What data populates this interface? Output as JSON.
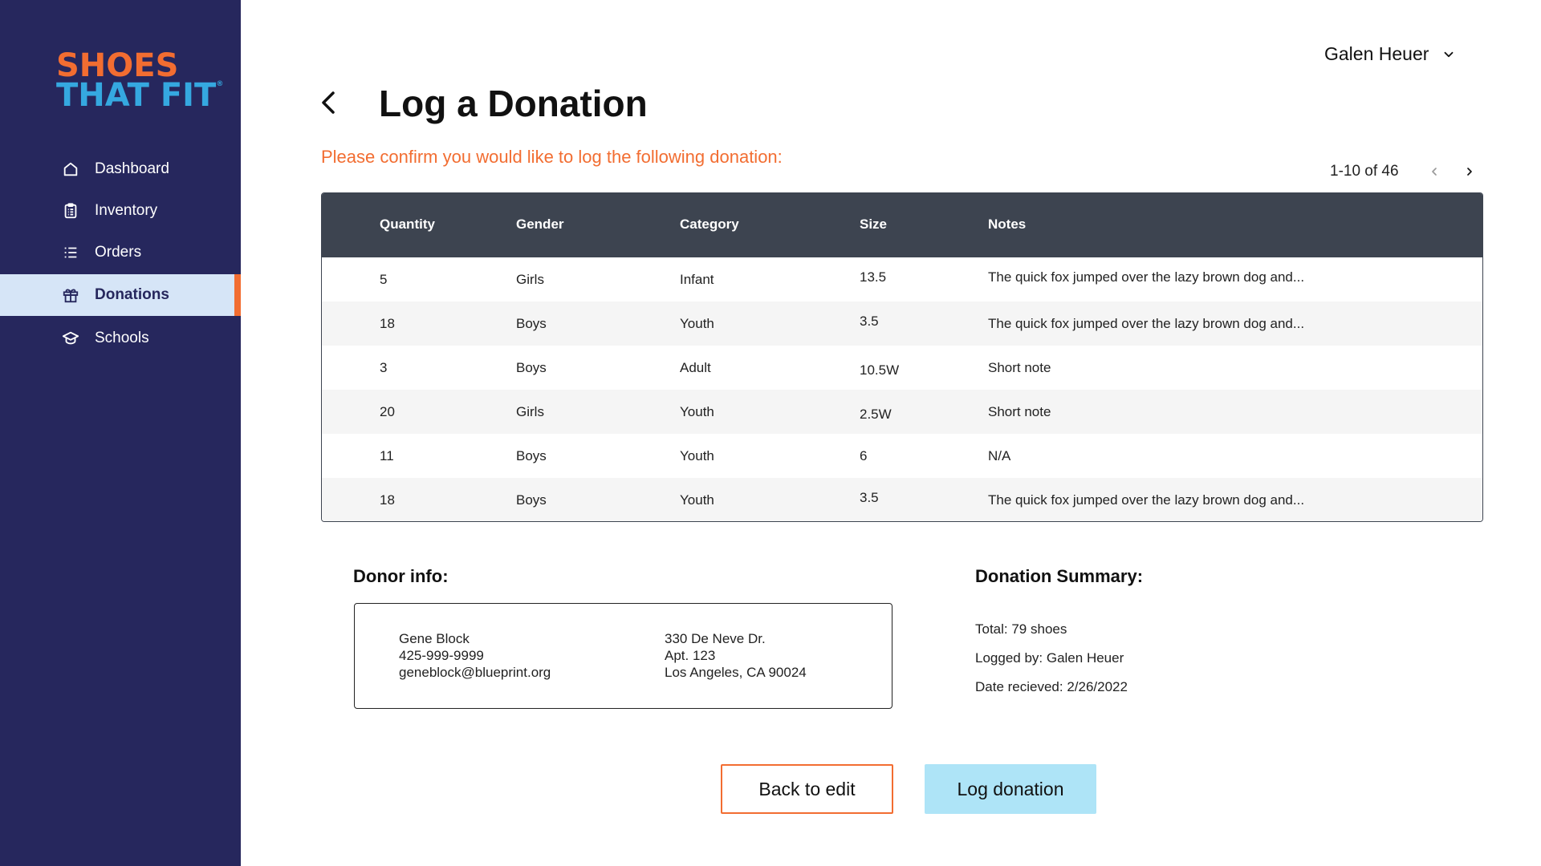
{
  "brand": {
    "line1": "SHOES",
    "line2": "THAT FIT",
    "mark": "®",
    "colors": {
      "orange": "#f26d31",
      "blue": "#35a8e0",
      "sidebar": "#26275d"
    }
  },
  "sidebar": {
    "items": [
      {
        "label": "Dashboard",
        "icon": "home-icon",
        "active": false
      },
      {
        "label": "Inventory",
        "icon": "clipboard-icon",
        "active": false
      },
      {
        "label": "Orders",
        "icon": "list-icon",
        "active": false
      },
      {
        "label": "Donations",
        "icon": "gift-icon",
        "active": true
      },
      {
        "label": "Schools",
        "icon": "graduation-cap-icon",
        "active": false
      }
    ]
  },
  "header": {
    "user_name": "Galen Heuer",
    "title": "Log a Donation",
    "confirm_text": "Please confirm you would like to log the following donation:"
  },
  "pager": {
    "text": "1-10 of 46"
  },
  "table": {
    "columns": [
      "Quantity",
      "Gender",
      "Category",
      "Size",
      "Notes"
    ],
    "rows": [
      [
        "5",
        "Girls",
        "Infant",
        "13.5",
        "The quick fox jumped over the lazy brown dog and..."
      ],
      [
        "18",
        "Boys",
        "Youth",
        "3.5",
        "The quick fox jumped over the lazy brown dog and..."
      ],
      [
        "3",
        "Boys",
        "Adult",
        "10.5W",
        "Short note"
      ],
      [
        "20",
        "Girls",
        "Youth",
        "2.5W",
        "Short note"
      ],
      [
        "11",
        "Boys",
        "Youth",
        "6",
        "N/A"
      ],
      [
        "18",
        "Boys",
        "Youth",
        "3.5",
        "The quick fox jumped over the lazy brown dog and..."
      ]
    ]
  },
  "donor": {
    "label": "Donor info:",
    "name": "Gene Block",
    "phone": "425-999-9999",
    "email": "geneblock@blueprint.org",
    "address1": "330 De Neve Dr.",
    "address2": "Apt. 123",
    "address3": "Los Angeles, CA 90024"
  },
  "summary": {
    "label": "Donation Summary:",
    "total": "Total: 79 shoes",
    "logged_by": "Logged by: Galen Heuer",
    "date": "Date recieved: 2/26/2022"
  },
  "buttons": {
    "back": "Back to edit",
    "log": "Log donation"
  }
}
